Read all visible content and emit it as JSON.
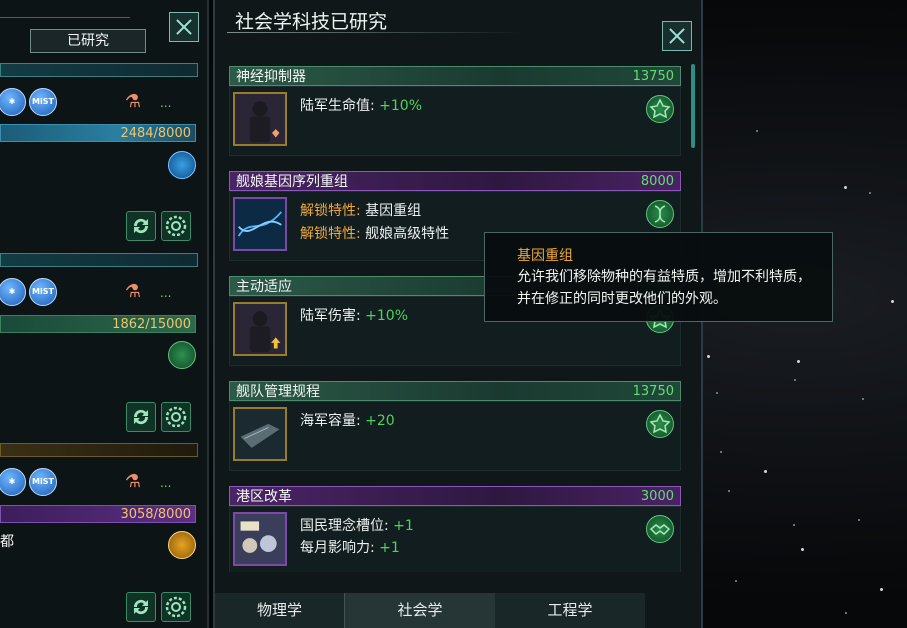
{
  "left_panel": {
    "researched_button": "已研究",
    "badge_text": "MiST",
    "more": "...",
    "slots": [
      {
        "progress": "2484/8000"
      },
      {
        "progress": "1862/15000"
      },
      {
        "progress": "3058/8000",
        "text": "都"
      }
    ]
  },
  "main": {
    "title": "社会学科技已研究",
    "techs": [
      {
        "name": "神经抑制器",
        "cost": "13750",
        "mods": [
          {
            "label": "陆军生命值: ",
            "value": "+10%"
          }
        ]
      },
      {
        "name": "舰娘基因序列重组",
        "cost": "8000",
        "mods": [
          {
            "label": "解锁特性: ",
            "value": "基因重组"
          },
          {
            "label": "解锁特性: ",
            "value": "舰娘高级特性"
          }
        ]
      },
      {
        "name": "主动适应",
        "cost": "",
        "mods": [
          {
            "label": "陆军伤害: ",
            "value": "+10%"
          }
        ]
      },
      {
        "name": "舰队管理规程",
        "cost": "13750",
        "mods": [
          {
            "label": "海军容量: ",
            "value": "+20"
          }
        ]
      },
      {
        "name": "港区改革",
        "cost": "3000",
        "mods": [
          {
            "label": "国民理念槽位: ",
            "value": "+1"
          },
          {
            "label": "每月影响力: ",
            "value": "+1"
          }
        ]
      }
    ],
    "tabs": [
      "物理学",
      "社会学",
      "工程学"
    ]
  },
  "tooltip": {
    "title": "基因重组",
    "body": "允许我们移除物种的有益特质，增加不利特质，并在修正的同时更改他们的外观。"
  },
  "colors": {
    "accent_green": "#4fd35c",
    "unlock_orange": "#f0a83c",
    "progress_gold": "#f1c36a",
    "society_purple": "#8a58b6"
  }
}
